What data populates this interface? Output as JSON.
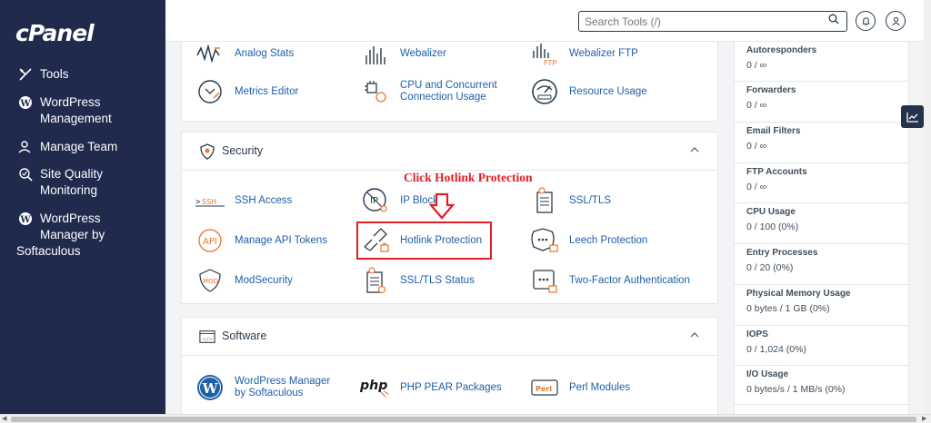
{
  "brand": {
    "logo": "cPanel"
  },
  "sidebar": {
    "items": [
      {
        "label": "Tools",
        "icon": "tools-icon"
      },
      {
        "label": "WordPress Management",
        "icon": "wordpress-icon"
      },
      {
        "label": "Manage Team",
        "icon": "team-icon"
      },
      {
        "label": "Site Quality Monitoring",
        "icon": "site-quality-icon"
      },
      {
        "label": "WordPress Manager by",
        "icon": "wordpress-icon"
      },
      {
        "label": "Softaculous",
        "icon": ""
      }
    ]
  },
  "topbar": {
    "search_placeholder": "Search Tools (/)"
  },
  "metrics_tools": [
    {
      "label": "Analog Stats",
      "icon": "analog-stats-icon"
    },
    {
      "label": "Webalizer",
      "icon": "webalizer-icon"
    },
    {
      "label": "Webalizer FTP",
      "icon": "webalizer-ftp-icon"
    },
    {
      "label": "Metrics Editor",
      "icon": "metrics-editor-icon"
    },
    {
      "label": "CPU and Concurrent Connection Usage",
      "icon": "cpu-usage-icon"
    },
    {
      "label": "Resource Usage",
      "icon": "resource-usage-icon"
    }
  ],
  "security": {
    "title": "Security",
    "tools": [
      {
        "label": "SSH Access",
        "icon": "ssh-icon"
      },
      {
        "label": "IP Blocker",
        "icon": "ip-blocker-icon"
      },
      {
        "label": "SSL/TLS",
        "icon": "ssl-tls-icon"
      },
      {
        "label": "Manage API Tokens",
        "icon": "api-icon"
      },
      {
        "label": "Hotlink Protection",
        "icon": "hotlink-icon"
      },
      {
        "label": "Leech Protection",
        "icon": "leech-icon"
      },
      {
        "label": "ModSecurity",
        "icon": "modsecurity-icon"
      },
      {
        "label": "SSL/TLS Status",
        "icon": "ssl-status-icon"
      },
      {
        "label": "Two-Factor Authentication",
        "icon": "two-factor-icon"
      }
    ]
  },
  "software": {
    "title": "Software",
    "tools": [
      {
        "label": "WordPress Manager by Softaculous",
        "icon": "wordpress-icon"
      },
      {
        "label": "PHP PEAR Packages",
        "icon": "php-icon"
      },
      {
        "label": "Perl Modules",
        "icon": "perl-icon"
      }
    ]
  },
  "stats": [
    {
      "label": "Autoresponders",
      "value": "0 / ∞"
    },
    {
      "label": "Forwarders",
      "value": "0 / ∞"
    },
    {
      "label": "Email Filters",
      "value": "0 / ∞"
    },
    {
      "label": "FTP Accounts",
      "value": "0 / ∞"
    },
    {
      "label": "CPU Usage",
      "value": "0 / 100   (0%)"
    },
    {
      "label": "Entry Processes",
      "value": "0 / 20   (0%)"
    },
    {
      "label": "Physical Memory Usage",
      "value": "0 bytes / 1 GB   (0%)"
    },
    {
      "label": "IOPS",
      "value": "0 / 1,024   (0%)"
    },
    {
      "label": "I/O Usage",
      "value": "0 bytes/s / 1 MB/s   (0%)"
    }
  ],
  "annotation": {
    "text": "Click Hotlink Protection"
  },
  "colors": {
    "sidebar": "#1f2a4d",
    "link": "#1e5fa8",
    "accent": "#e8772e",
    "annotation": "#e41e26"
  }
}
